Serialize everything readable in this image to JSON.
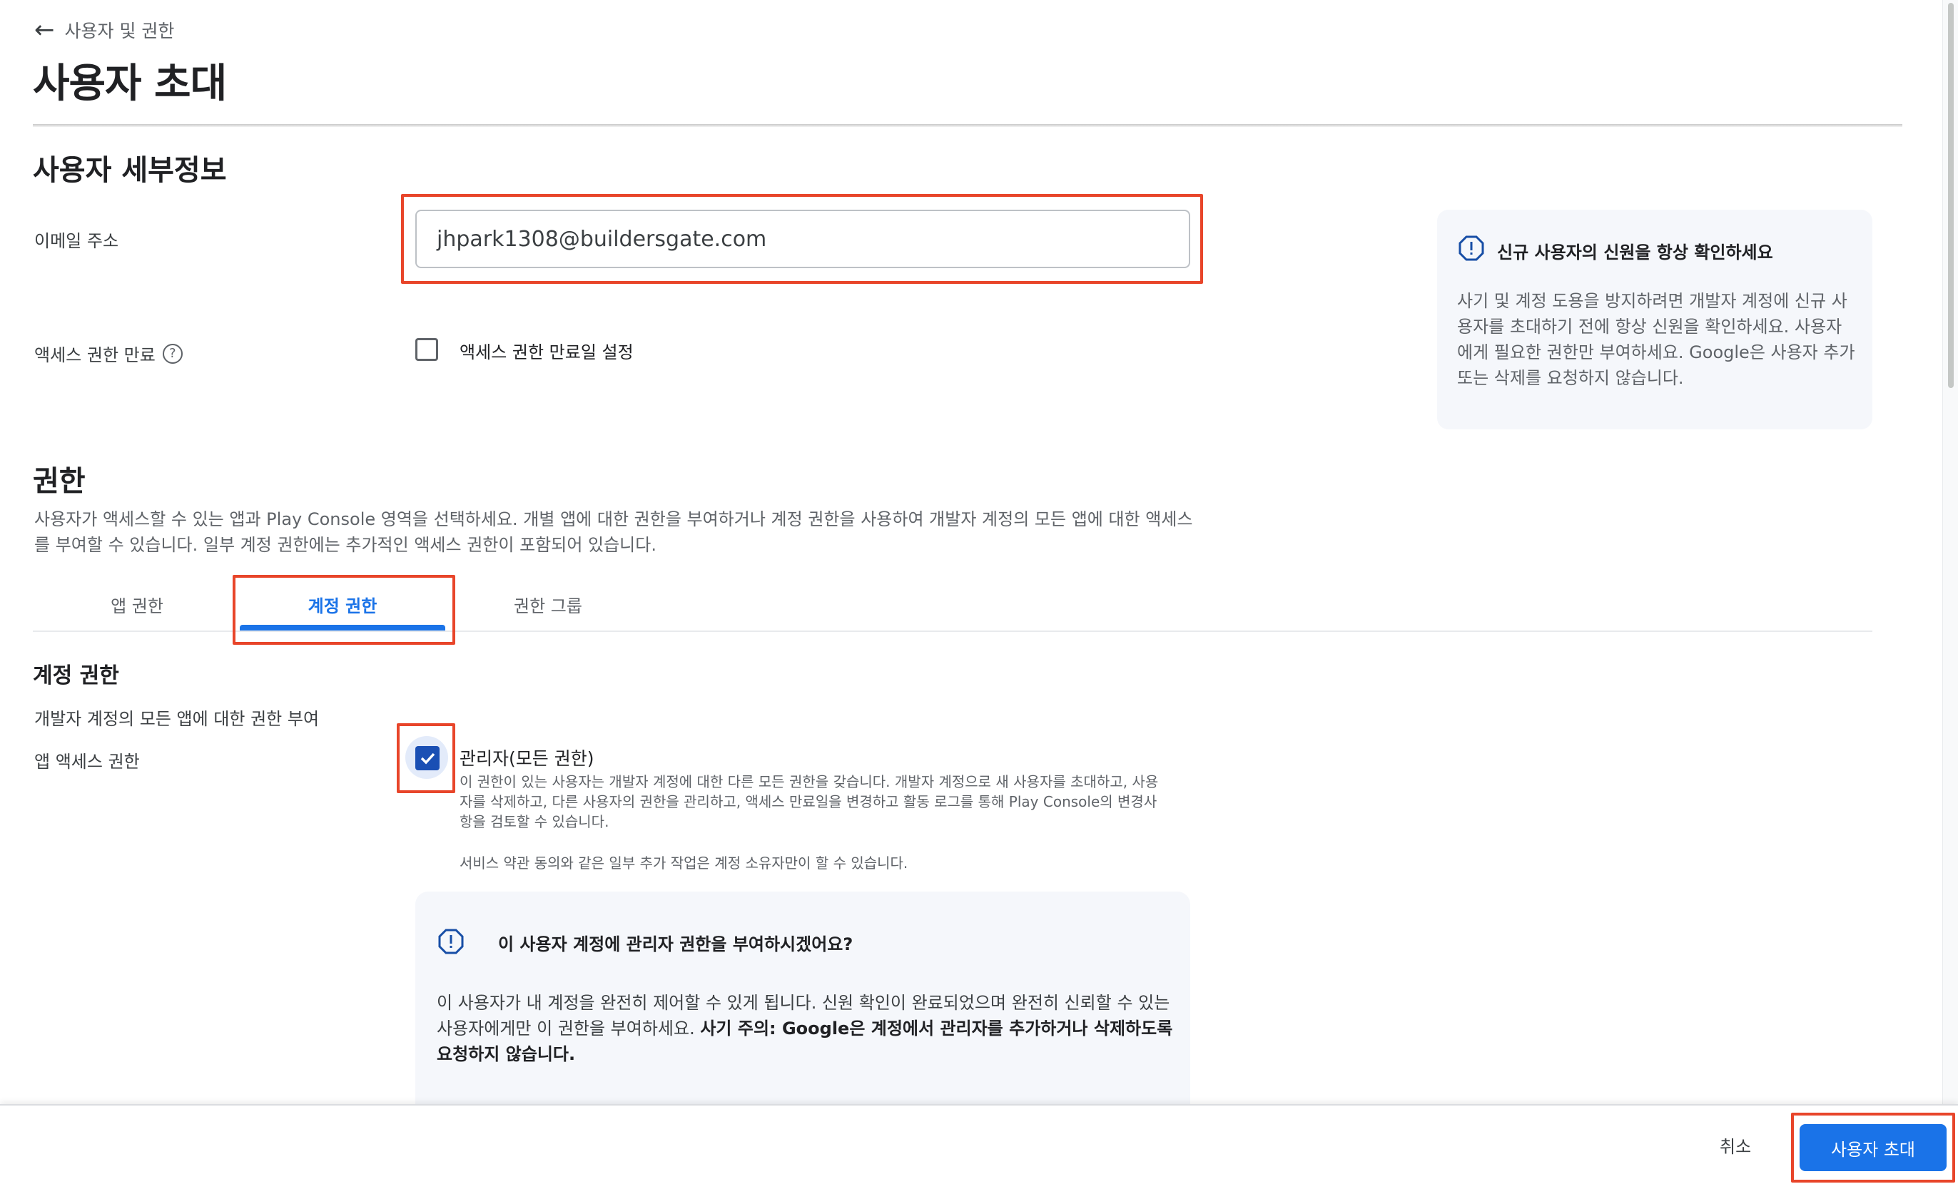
{
  "header": {
    "back_label": "사용자 및 권한",
    "title": "사용자 초대"
  },
  "details": {
    "section_title": "사용자 세부정보",
    "email_label": "이메일 주소",
    "email_value": "jhpark1308@buildersgate.com",
    "expiry_label": "액세스 권한 만료",
    "expiry_checkbox_label": "액세스 권한 만료일 설정",
    "expiry_checked": false
  },
  "info_card": {
    "title": "신규 사용자의 신원을 항상 확인하세요",
    "lines": [
      "사기 및 계정 도용을 방지하려면 개발자 계정에 신규 사",
      "용자를 초대하기 전에 항상 신원을 확인하세요. 사용자",
      "에게 필요한 권한만 부여하세요. Google은 사용자 추가",
      "또는 삭제를 요청하지 않습니다."
    ]
  },
  "permissions": {
    "title": "권한",
    "desc_lines": [
      "사용자가 액세스할 수 있는 앱과 Play Console 영역을 선택하세요. 개별 앱에 대한 권한을 부여하거나 계정 권한을 사용하여 개발자 계정의 모든 앱에 대한 액세스",
      "를 부여할 수 있습니다. 일부 계정 권한에는 추가적인 액세스 권한이 포함되어 있습니다."
    ],
    "tabs": [
      {
        "label": "앱 권한",
        "active": false
      },
      {
        "label": "계정 권한",
        "active": true
      },
      {
        "label": "권한 그룹",
        "active": false
      }
    ],
    "account": {
      "title": "계정 권한",
      "subtitle": "개발자 계정의 모든 앱에 대한 권한 부여",
      "access_label": "앱 액세스 권한",
      "admin_title": "관리자(모든 권한)",
      "admin_checked": true,
      "admin_desc_lines": [
        "이 권한이 있는 사용자는 개발자 계정에 대한 다른 모든 권한을 갖습니다. 개발자 계정으로 새 사용자를 초대하고, 사용",
        "자를 삭제하고, 다른 사용자의 권한을 관리하고, 액세스 만료일을 변경하고 활동 로그를 통해 Play Console의 변경사",
        "항을 검토할 수 있습니다."
      ],
      "admin_note": "서비스 약관 동의와 같은 일부 추가 작업은 계정 소유자만이 할 수 있습니다."
    },
    "warning": {
      "title": "이 사용자 계정에 관리자 권한을 부여하시겠어요?",
      "line1": "이 사용자가 내 계정을 완전히 제어할 수 있게 됩니다. 신원 확인이 완료되었으며 완전히 신뢰할 수 있는",
      "line2_normal": "사용자에게만 이 권한을 부여하세요. ",
      "line2_bold": "사기 주의: Google은 계정에서 관리자를 추가하거나 삭제하도록",
      "line3_bold": "요청하지 않습니다."
    }
  },
  "footer": {
    "cancel_label": "취소",
    "invite_label": "사용자 초대"
  },
  "icons": {
    "back": "arrow-left-icon",
    "help": "help-circle-icon",
    "warning": "warning-octagon-icon",
    "check": "checkmark-icon"
  },
  "colors": {
    "accent": "#1a73e8",
    "checkbox": "#1a4fb4",
    "highlight": "#e8452a",
    "card_bg": "#f5f7fb"
  }
}
